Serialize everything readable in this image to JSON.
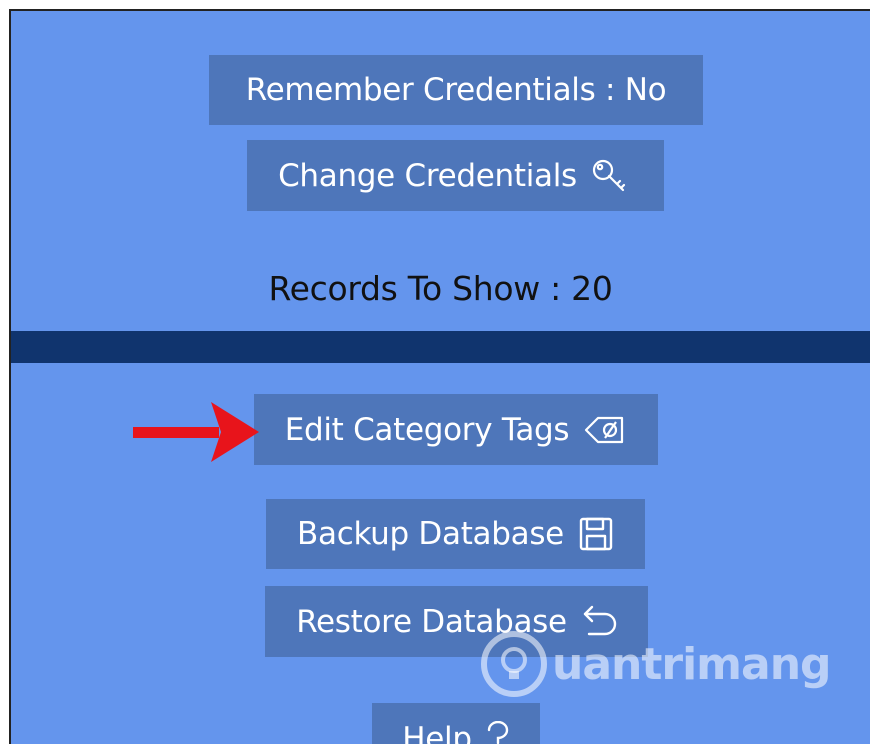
{
  "settings": {
    "remember_label": "Remember Credentials : No",
    "change_label": "Change Credentials",
    "records_label": "Records To Show : 20"
  },
  "actions": {
    "edit_tags_label": "Edit Category Tags",
    "backup_label": "Backup Database",
    "restore_label": "Restore Database",
    "help_label": "Help"
  },
  "icons": {
    "change": "key-icon",
    "edit_tags": "tag-icon",
    "backup": "save-icon",
    "restore": "undo-icon",
    "help": "question-icon"
  },
  "watermark": {
    "text": "uantrimang"
  },
  "colors": {
    "panel": "#6495ED",
    "button": "#4E76BA",
    "divider": "#10346E",
    "arrow": "#E8141B"
  }
}
